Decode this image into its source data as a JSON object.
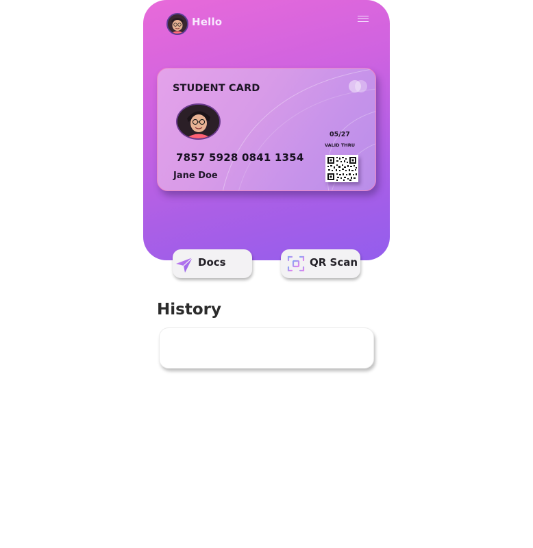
{
  "header": {
    "greeting": "Hello",
    "avatar_icon": "user-avatar-icon",
    "menu_icon": "hamburger-menu-icon"
  },
  "card": {
    "title": "STUDENT CARD",
    "number": "7857 5928 0841 1354",
    "holder_name": "Jane Doe",
    "expiry": "05/27",
    "expiry_label": "VALID THRU",
    "logo_icon": "card-logo-circles-icon",
    "qr_icon": "qr-code-icon"
  },
  "actions": [
    {
      "label": "Docs",
      "icon": "send-arrow-icon"
    },
    {
      "label": "QR Scan",
      "icon": "qr-scan-icon"
    }
  ],
  "history": {
    "title": "History"
  },
  "colors": {
    "gradient_start": "#e86ad9",
    "gradient_end": "#935ded",
    "accent": "#b46bf0"
  }
}
